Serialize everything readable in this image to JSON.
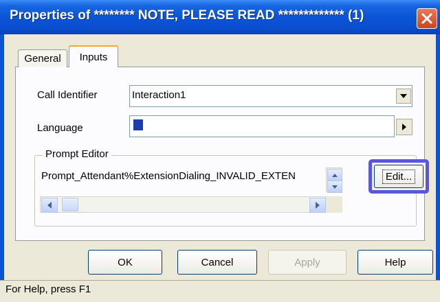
{
  "window": {
    "title": "Properties of ******** NOTE, PLEASE READ ************* (1)"
  },
  "tabs": [
    {
      "label": "General",
      "selected": false
    },
    {
      "label": "Inputs",
      "selected": true
    }
  ],
  "form": {
    "call_identifier_label": "Call Identifier",
    "call_identifier_value": "Interaction1",
    "language_label": "Language",
    "language_value": ""
  },
  "prompt_editor": {
    "group_label": "Prompt Editor",
    "prompt_value": "Prompt_Attendant%ExtensionDialing_INVALID_EXTEN",
    "edit_label": "Edit..."
  },
  "buttons": {
    "ok": "OK",
    "cancel": "Cancel",
    "apply": "Apply",
    "help": "Help"
  },
  "status_bar": {
    "text": "For Help, press F1"
  },
  "colors": {
    "titlebar": "#0a55d6",
    "highlight_glow": "#5c56dc",
    "close_button": "#d8512b"
  },
  "icons": [
    "close-icon",
    "dropdown-arrow-icon",
    "right-arrow-icon",
    "scroll-up-icon",
    "scroll-down-icon",
    "scroll-left-icon",
    "scroll-right-icon"
  ]
}
